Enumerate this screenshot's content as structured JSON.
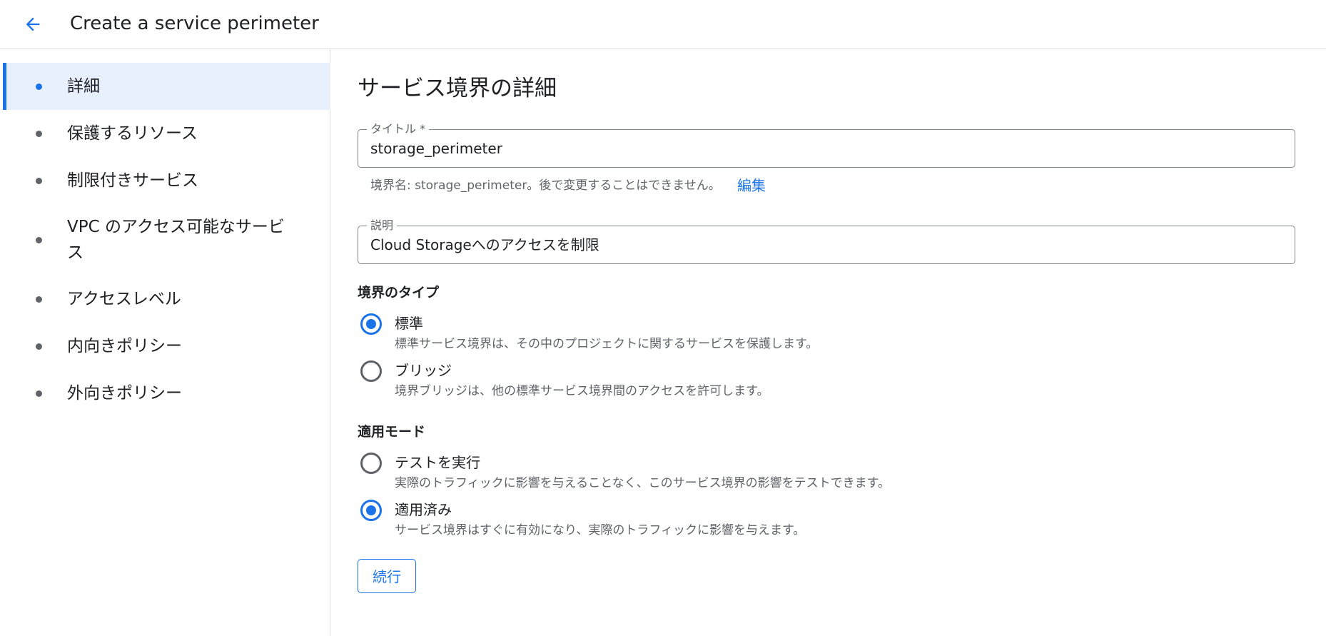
{
  "header": {
    "title": "Create a service perimeter",
    "back_icon": "arrow-back-icon"
  },
  "sidebar": {
    "items": [
      {
        "label": "詳細",
        "active": true
      },
      {
        "label": "保護するリソース",
        "active": false
      },
      {
        "label": "制限付きサービス",
        "active": false
      },
      {
        "label": "VPC のアクセス可能なサービス",
        "active": false
      },
      {
        "label": "アクセスレベル",
        "active": false
      },
      {
        "label": "内向きポリシー",
        "active": false
      },
      {
        "label": "外向きポリシー",
        "active": false
      }
    ]
  },
  "main": {
    "section_title": "サービス境界の詳細",
    "title_field": {
      "label": "タイトル *",
      "value": "storage_perimeter"
    },
    "perimeter_name_helper": "境界名: storage_perimeter。後で変更することはできません。",
    "edit_link": "編集",
    "description_field": {
      "label": "説明",
      "value": "Cloud Storageへのアクセスを制限"
    },
    "perimeter_type": {
      "title": "境界のタイプ",
      "options": [
        {
          "label": "標準",
          "description": "標準サービス境界は、その中のプロジェクトに関するサービスを保護します。",
          "checked": true
        },
        {
          "label": "ブリッジ",
          "description": "境界ブリッジは、他の標準サービス境界間のアクセスを許可します。",
          "checked": false
        }
      ]
    },
    "enforcement_mode": {
      "title": "適用モード",
      "options": [
        {
          "label": "テストを実行",
          "description": "実際のトラフィックに影響を与えることなく、このサービス境界の影響をテストできます。",
          "checked": false
        },
        {
          "label": "適用済み",
          "description": "サービス境界はすぐに有効になり、実際のトラフィックに影響を与えます。",
          "checked": true
        }
      ]
    },
    "continue_label": "続行"
  },
  "colors": {
    "accent": "#1a73e8",
    "active_bg": "#e8f0fe",
    "border": "#dadce0"
  }
}
